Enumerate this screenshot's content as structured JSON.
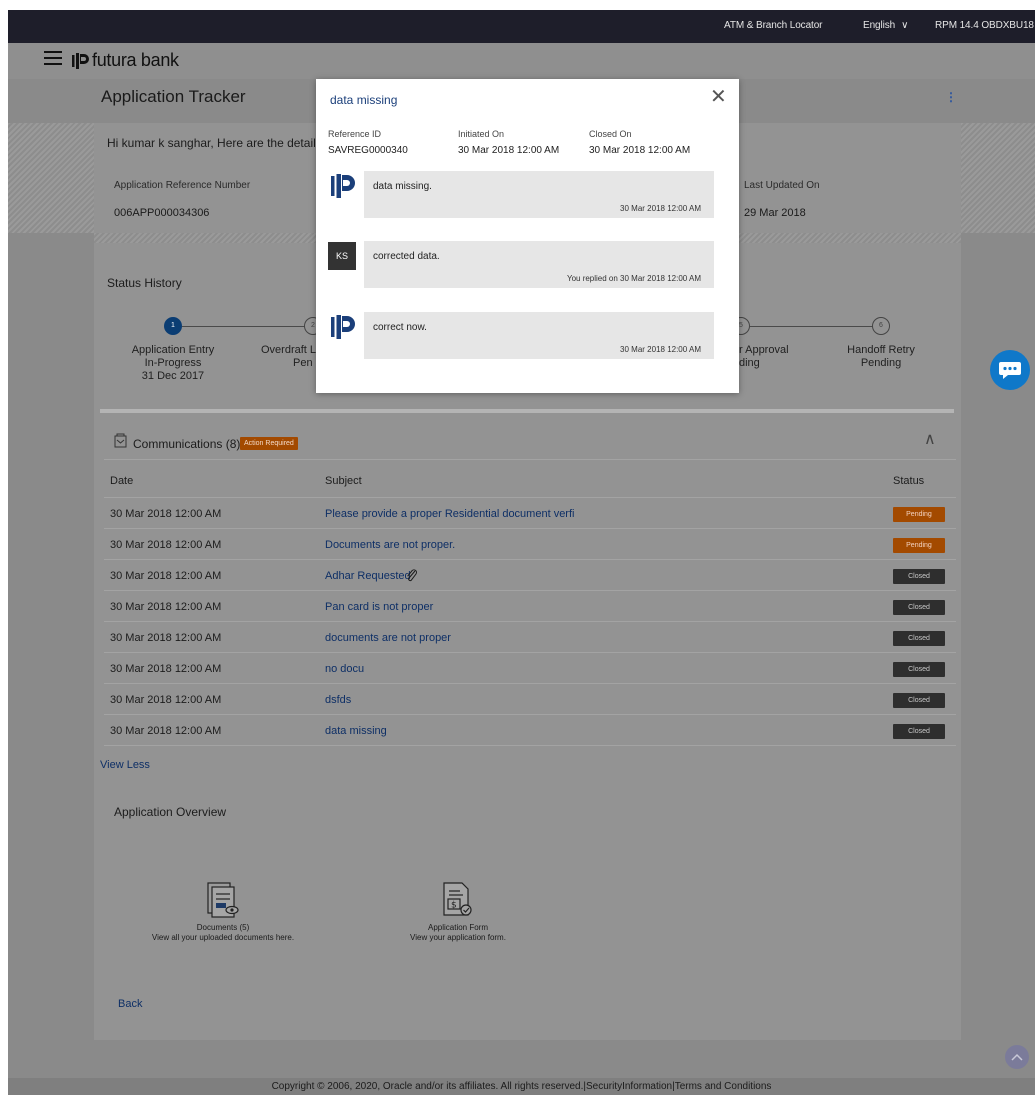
{
  "topbar": {
    "locator": "ATM & Branch Locator",
    "language": "English",
    "user": "RPM 14.4 OBDXBU18"
  },
  "header": {
    "brand": "futura bank"
  },
  "page": {
    "title": "Application Tracker"
  },
  "info_card": {
    "greeting": "Hi kumar k sanghar, Here are the details c",
    "app_ref_label": "Application Reference Number",
    "app_ref_value": "006APP000034306",
    "last_updated_label": "Last Updated On",
    "last_updated_value": "29 Mar 2018"
  },
  "status_history": {
    "title": "Status History",
    "steps": [
      {
        "num": "1",
        "l1": "Application Entry",
        "l2": "In-Progress",
        "l3": "31 Dec 2017"
      },
      {
        "num": "2",
        "l1": "Overdraft L",
        "l2": "Pen",
        "l3": ""
      },
      {
        "num": "5",
        "l1": "r Approval",
        "l2": "ding",
        "l3": ""
      },
      {
        "num": "6",
        "l1": "Handoff Retry",
        "l2": "Pending",
        "l3": ""
      }
    ]
  },
  "communications": {
    "title": "Communications (8)",
    "action_badge": "Action Required",
    "columns": {
      "date": "Date",
      "subject": "Subject",
      "status": "Status"
    },
    "rows": [
      {
        "date": "30 Mar 2018 12:00 AM",
        "subject": "Please provide a proper Residential document verfi",
        "status": "Pending",
        "state": "pending"
      },
      {
        "date": "30 Mar 2018 12:00 AM",
        "subject": "Documents are not proper.",
        "status": "Pending",
        "state": "pending"
      },
      {
        "date": "30 Mar 2018 12:00 AM",
        "subject": "Adhar Requested",
        "status": "Closed",
        "state": "closed",
        "attachment": true
      },
      {
        "date": "30 Mar 2018 12:00 AM",
        "subject": "Pan card is not proper",
        "status": "Closed",
        "state": "closed"
      },
      {
        "date": "30 Mar 2018 12:00 AM",
        "subject": "documents are not proper",
        "status": "Closed",
        "state": "closed"
      },
      {
        "date": "30 Mar 2018 12:00 AM",
        "subject": "no docu",
        "status": "Closed",
        "state": "closed"
      },
      {
        "date": "30 Mar 2018 12:00 AM",
        "subject": "dsfds",
        "status": "Closed",
        "state": "closed"
      },
      {
        "date": "30 Mar 2018 12:00 AM",
        "subject": "data missing",
        "status": "Closed",
        "state": "closed"
      }
    ],
    "view_less": "View Less"
  },
  "overview": {
    "title": "Application Overview",
    "documents_title": "Documents (5)",
    "documents_desc": "View all your uploaded documents here.",
    "form_title": "Application Form",
    "form_desc": "View your application form."
  },
  "back_label": "Back",
  "footer": "Copyright © 2006, 2020, Oracle and/or its affiliates. All rights reserved.|SecurityInformation|Terms and Conditions",
  "modal": {
    "title": "data missing",
    "ref_label": "Reference ID",
    "ref_value": "SAVREG0000340",
    "initiated_label": "Initiated On",
    "initiated_value": "30 Mar 2018 12:00 AM",
    "closed_label": "Closed On",
    "closed_value": "30 Mar 2018 12:00 AM",
    "messages": [
      {
        "sender": "bank",
        "text": "data missing.",
        "time": "30 Mar 2018 12:00 AM"
      },
      {
        "sender": "user",
        "initials": "KS",
        "text": "corrected data.",
        "time": "You replied on 30 Mar 2018 12:00 AM"
      },
      {
        "sender": "bank",
        "text": "correct now.",
        "time": "30 Mar 2018 12:00 AM"
      }
    ]
  },
  "colors": {
    "topbar": "#1e1e2a",
    "overlay": "#8a8a8a",
    "pending": "#a34a00",
    "closed": "#2e2e2e",
    "link": "#1b3f7a",
    "fab": "#0f78c9"
  }
}
